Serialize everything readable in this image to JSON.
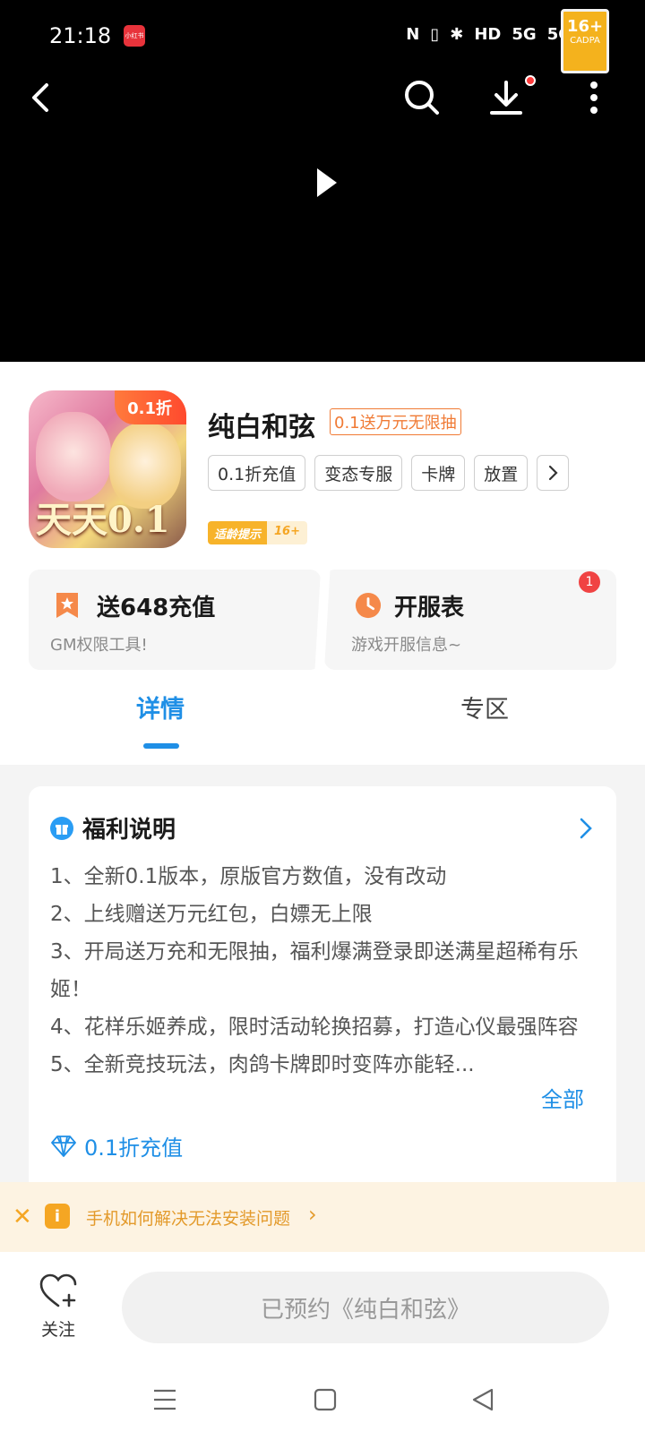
{
  "status_bar": {
    "time": "21:18",
    "app_badge": "小红书",
    "icons": [
      "N",
      "▯",
      "✱",
      "HD",
      "5G",
      "5G"
    ],
    "age_rating": "16+",
    "age_badge_text": "CADPA"
  },
  "video": {
    "back_icon": "back-arrow-icon",
    "search_icon": "search-icon",
    "download_icon": "download-icon",
    "more_icon": "more-vertical-icon",
    "play_icon": "play-icon"
  },
  "game": {
    "icon_discount": "0.1折",
    "icon_art_text": "天天0.1",
    "name": "纯白和弦",
    "promo_tag": "0.1送万元无限抽",
    "tags": [
      "0.1折充值",
      "变态专服",
      "卡牌",
      "放置"
    ],
    "age_tip_label": "适龄提示",
    "age_tip_value": "16+"
  },
  "cards": {
    "left": {
      "title": "送648充值",
      "subtitle": "GM权限工具!"
    },
    "right": {
      "title": "开服表",
      "subtitle": "游戏开服信息~",
      "badge": "1"
    }
  },
  "tabs": {
    "details": "详情",
    "zone": "专区"
  },
  "benefits": {
    "title": "福利说明",
    "lines": [
      "1、全新0.1版本，原版官方数值，没有改动",
      "2、上线赠送万元红包，白嫖无上限",
      "3、开局送万充和无限抽，福利爆满登录即送满星超稀有乐姬！",
      "4、花样乐姬养成，限时活动轮换招募，打造心仪最强阵容",
      "5、全新竞技玩法，肉鸽卡牌即时变阵亦能轻..."
    ],
    "see_all": "全部",
    "recharge": "0.1折充值"
  },
  "install_tip": {
    "text": "手机如何解决无法安装问题"
  },
  "bottom": {
    "follow": "关注",
    "reserve": "已预约《纯白和弦》"
  },
  "colors": {
    "accent": "#1f8fe6",
    "orange": "#f07a34",
    "tip": "#e39a2b"
  }
}
